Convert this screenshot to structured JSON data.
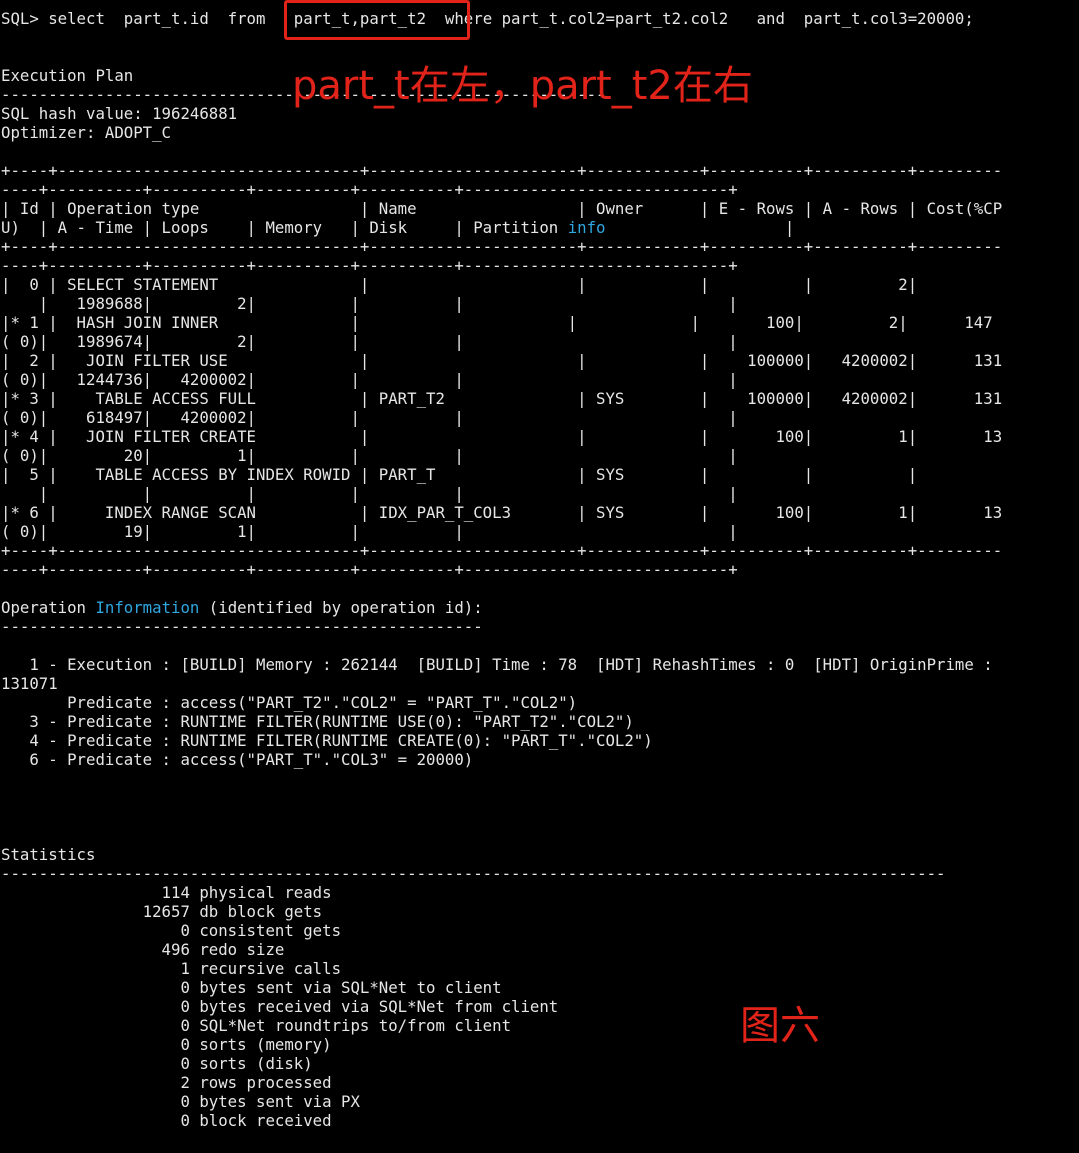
{
  "sql_cmd": {
    "prefix": "SQL> select  part_t.id  from  ",
    "tables": " part_t,part_t2 ",
    "suffix": " where part_t.col2=part_t2.col2   and  part_t.col3=20000;"
  },
  "annotations": {
    "note_top": "part_t在左，part_t2在右",
    "figure_label": "图六"
  },
  "plan_header": {
    "title": "Execution Plan",
    "rule": "----------------------------------------------------------------",
    "hash": "SQL hash value: 196246881",
    "optimizer": "Optimizer: ADOPT_C"
  },
  "table": {
    "sep_a": "+----+--------------------------------+----------------------+------------+----------+----------+---------",
    "sep_b": "----+----------+----------+----------+----------+----------------------------+",
    "header_1": "| Id | Operation type                 | Name                 | Owner      | E - Rows | A - Rows | Cost(%CP",
    "header_2_pre": "U)  | A - Time | Loops    | Memory   | Disk     | Partition ",
    "header_2_info": "info",
    "header_2_post": "                   |",
    "rows": [
      {
        "l1": "|  0 | SELECT STATEMENT               |                      |            |          |         2|",
        "l2": "    |   1989688|         2|          |          |                            |"
      },
      {
        "l1": "|* 1 |  HASH JOIN INNER              |                      |            |       100|         2|      147",
        "l2": "( 0)|   1989674|         2|          |          |                            |"
      },
      {
        "l1": "|  2 |   JOIN FILTER USE              |                      |            |    100000|   4200002|      131",
        "l2": "( 0)|   1244736|   4200002|          |          |                            |"
      },
      {
        "l1": "|* 3 |    TABLE ACCESS FULL           | PART_T2              | SYS        |    100000|   4200002|      131",
        "l2": "( 0)|    618497|   4200002|          |          |                            |"
      },
      {
        "l1": "|* 4 |   JOIN FILTER CREATE           |                      |            |       100|         1|       13",
        "l2": "( 0)|        20|         1|          |          |                            |"
      },
      {
        "l1": "|  5 |    TABLE ACCESS BY INDEX ROWID | PART_T               | SYS        |          |          |",
        "l2": "    |          |          |          |          |                            |"
      },
      {
        "l1": "|* 6 |     INDEX RANGE SCAN           | IDX_PAR_T_COL3       | SYS        |       100|         1|       13",
        "l2": "( 0)|        19|         1|          |          |                            |"
      }
    ]
  },
  "opinfo": {
    "title_pre": "Operation ",
    "title_info": "Information",
    "title_post": " (identified by operation id):",
    "rule": "---------------------------------------------------",
    "lines": [
      "   1 - Execution : [BUILD] Memory : 262144  [BUILD] Time : 78  [HDT] RehashTimes : 0  [HDT] OriginPrime :",
      "131071",
      "       Predicate : access(\"PART_T2\".\"COL2\" = \"PART_T\".\"COL2\")",
      "   3 - Predicate : RUNTIME FILTER(RUNTIME USE(0): \"PART_T2\".\"COL2\")",
      "   4 - Predicate : RUNTIME FILTER(RUNTIME CREATE(0): \"PART_T\".\"COL2\")",
      "   6 - Predicate : access(\"PART_T\".\"COL3\" = 20000)"
    ]
  },
  "statistics": {
    "title": "Statistics",
    "rule": "----------------------------------------------------------------------------------------------------",
    "lines": [
      "                 114 physical reads",
      "               12657 db block gets",
      "                   0 consistent gets",
      "                 496 redo size",
      "                   1 recursive calls",
      "                   0 bytes sent via SQL*Net to client",
      "                   0 bytes received via SQL*Net from client",
      "                   0 SQL*Net roundtrips to/from client",
      "                   0 sorts (memory)",
      "                   0 sorts (disk)",
      "                   2 rows processed",
      "                   0 bytes sent via PX",
      "                   0 block received"
    ]
  }
}
